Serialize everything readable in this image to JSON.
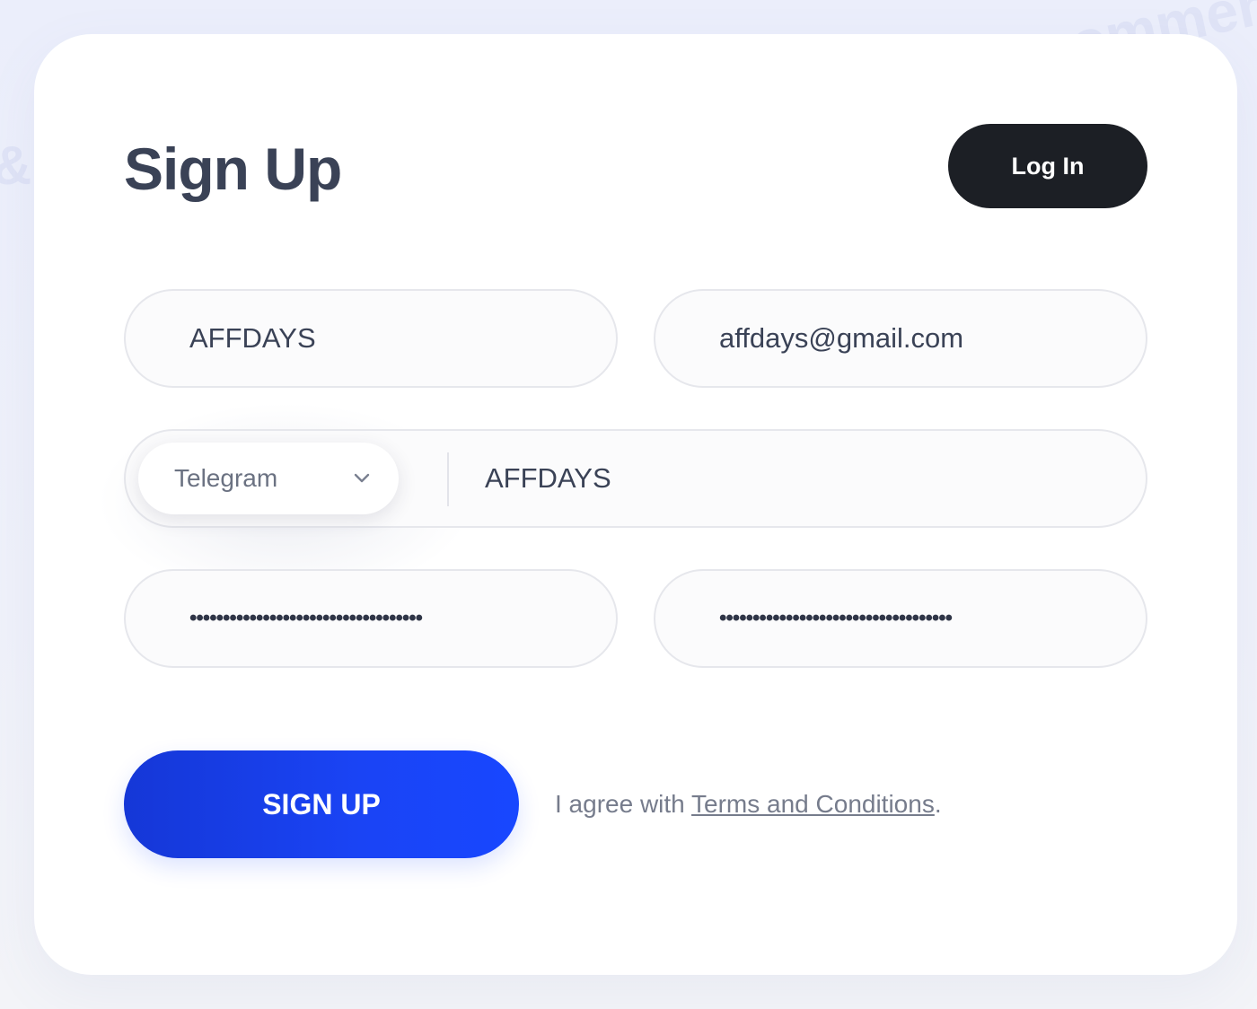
{
  "background": {
    "words": [
      "ecommerce",
      "&"
    ]
  },
  "header": {
    "title": "Sign Up",
    "login_label": "Log In"
  },
  "form": {
    "username_value": "AFFDAYS",
    "email_value": "affdays@gmail.com",
    "messenger": {
      "selected": "Telegram",
      "handle_value": "AFFDAYS"
    },
    "password_mask": "•••••••••••••••••••••••••••••••••••",
    "password_confirm_mask": "•••••••••••••••••••••••••••••••••••"
  },
  "actions": {
    "signup_label": "SIGN UP",
    "agree_prefix": "I agree with ",
    "terms_link": "Terms and Conditions",
    "agree_suffix": "."
  },
  "colors": {
    "accent": "#1847ff",
    "dark_button": "#1c1f25",
    "title_text": "#3a4256"
  }
}
